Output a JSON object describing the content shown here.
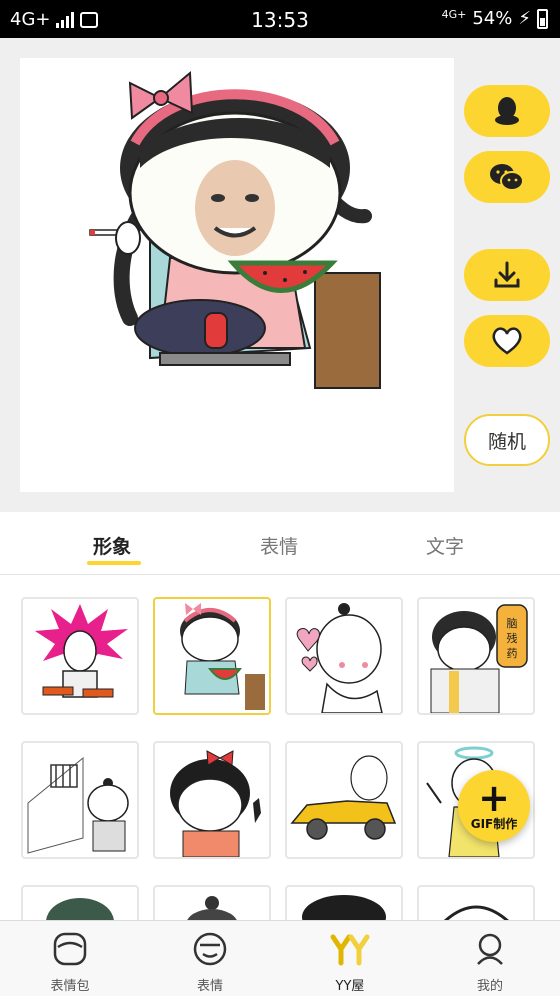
{
  "status_bar": {
    "network": "4G+",
    "time": "13:53",
    "network_right": "4G",
    "network_right_sub": "+",
    "battery": "54%"
  },
  "side_buttons": {
    "random_label": "随机"
  },
  "tabs": [
    {
      "label": "形象",
      "active": true
    },
    {
      "label": "表情",
      "active": false
    },
    {
      "label": "文字",
      "active": false
    }
  ],
  "grid_items": [
    {
      "name": "spiky-pink-hair-girl"
    },
    {
      "name": "bow-girl-watermelon",
      "selected": true
    },
    {
      "name": "bun-baby-hearts"
    },
    {
      "name": "medicine-bottle-boy",
      "bottle_text": "脑残药"
    },
    {
      "name": "prisoner-boy"
    },
    {
      "name": "red-bow-girl"
    },
    {
      "name": "yellow-car"
    },
    {
      "name": "angel-pointing"
    }
  ],
  "gif_fab": {
    "label": "GIF制作"
  },
  "bottom_nav": [
    {
      "label": "表情包",
      "active": false
    },
    {
      "label": "表情",
      "active": false
    },
    {
      "label": "YY屋",
      "active": true
    },
    {
      "label": "我的",
      "active": false
    }
  ],
  "colors": {
    "accent": "#fcd531",
    "bow_pink": "#e86a80",
    "watermelon": "#e23b3b"
  }
}
